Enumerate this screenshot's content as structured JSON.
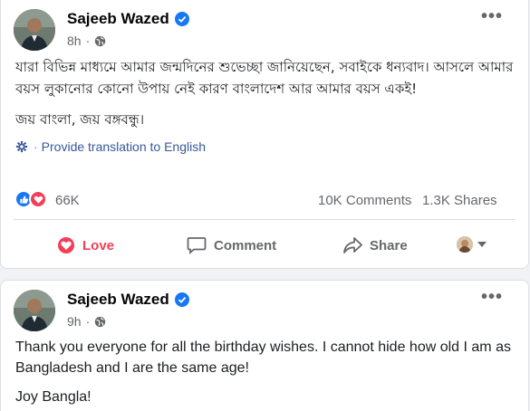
{
  "post1": {
    "author": "Sajeeb Wazed",
    "time": "8h",
    "dot": "·",
    "text_lines": [
      "যারা বিভিন্ন মাধ্যমে আমার জন্মদিনের শুভেচ্ছা জানিয়েছেন, সবাইকে ধন্যবাদ। আসলে আমার বয়স লুকানোর কোনো উপায় নেই কারণ বাংলাদেশ আর আমার বয়স একই!",
      "জয় বাংলা, জয় বঙ্গবন্ধু।"
    ],
    "translate_link": "Provide translation to English",
    "translate_sep": "·",
    "reactions_count": "66K",
    "comments": "10K Comments",
    "shares": "1.3K Shares",
    "actions": {
      "love": "Love",
      "comment": "Comment",
      "share": "Share"
    },
    "more_icon": "•••"
  },
  "post2": {
    "author": "Sajeeb Wazed",
    "time": "9h",
    "dot": "·",
    "text_lines": [
      "Thank you everyone for all the birthday wishes. I cannot hide how old I am as Bangladesh and I are the same age!",
      "Joy Bangla!"
    ],
    "more_icon": "•••"
  },
  "colors": {
    "accent": "#1877f2",
    "love": "#f33e58",
    "link": "#385898",
    "muted": "#65676b"
  },
  "icons": {
    "verified": "verified-badge-icon",
    "globe": "globe-icon",
    "gear": "gear-icon",
    "like": "like-icon",
    "love": "heart-icon",
    "comment": "comment-icon",
    "share": "share-icon",
    "more": "more-icon"
  }
}
